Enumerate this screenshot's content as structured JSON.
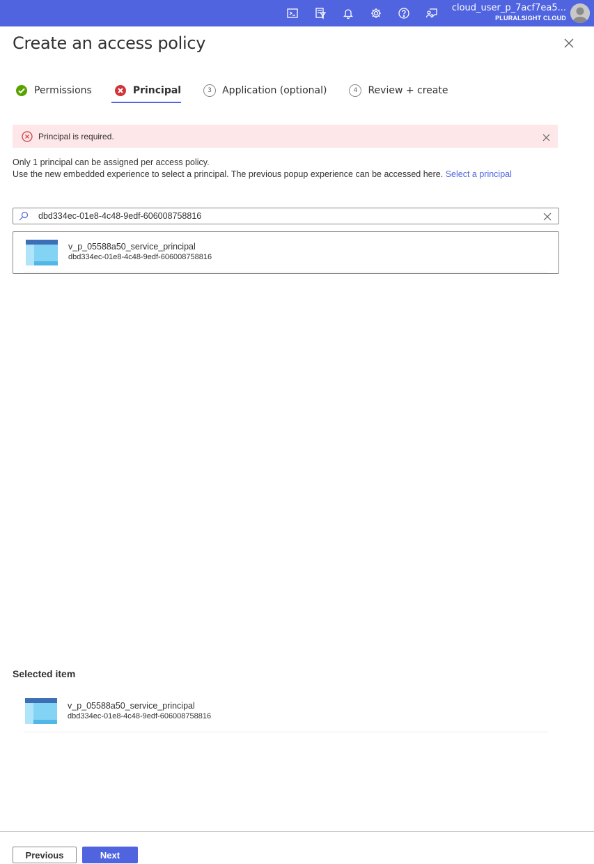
{
  "topbar": {
    "user": "cloud_user_p_7acf7ea5...",
    "tenant": "PLURALSIGHT CLOUD",
    "icons": [
      "cloud-shell-icon",
      "directory-filter-icon",
      "notifications-icon",
      "settings-icon",
      "help-icon",
      "feedback-icon"
    ]
  },
  "page": {
    "title": "Create an access policy"
  },
  "tabs": [
    {
      "label": "Permissions",
      "state": "complete"
    },
    {
      "label": "Principal",
      "state": "error"
    },
    {
      "label": "Application (optional)",
      "step": "3"
    },
    {
      "label": "Review + create",
      "step": "4"
    }
  ],
  "banner": {
    "message": "Principal is required."
  },
  "info": {
    "line1": "Only 1 principal can be assigned per access policy.",
    "line2": "Use the new embedded experience to select a principal. The previous popup experience can be accessed here.",
    "link": "Select a principal"
  },
  "search": {
    "value": "dbd334ec-01e8-4c48-9edf-606008758816"
  },
  "result": {
    "name": "v_p_05588a50_service_principal",
    "id": "dbd334ec-01e8-4c48-9edf-606008758816"
  },
  "selected": {
    "heading": "Selected item",
    "name": "v_p_05588a50_service_principal",
    "id": "dbd334ec-01e8-4c48-9edf-606008758816"
  },
  "footer": {
    "previous": "Previous",
    "next": "Next"
  },
  "colors": {
    "accent": "#5064e0",
    "error": "#d13438",
    "success": "#57a300",
    "banner_bg": "#fde7e9"
  }
}
